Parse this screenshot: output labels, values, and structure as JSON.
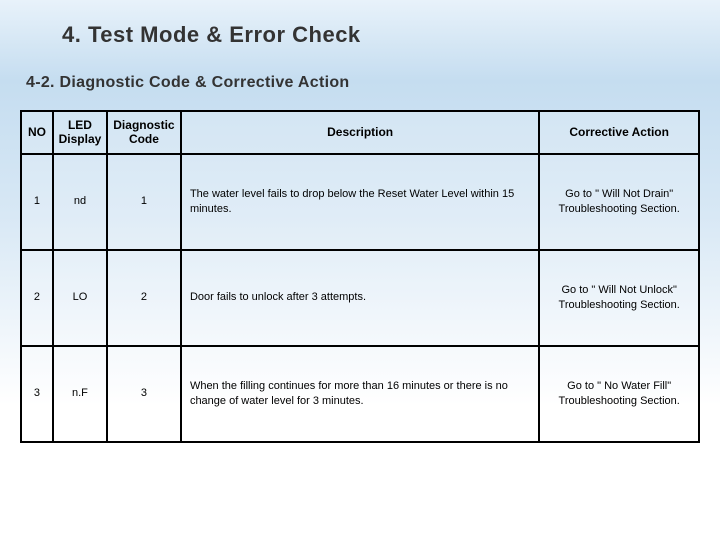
{
  "title": "4. Test Mode & Error Check",
  "subtitle": "4-2. Diagnostic Code & Corrective Action",
  "headers": {
    "no": "NO",
    "led": "LED Display",
    "code": "Diagnostic Code",
    "desc": "Description",
    "corr": "Corrective Action"
  },
  "rows": [
    {
      "no": "1",
      "led": "nd",
      "code": "1",
      "desc": "The water level fails to drop below the Reset Water Level within 15 minutes.",
      "corr": "Go to \" Will Not Drain\" Troubleshooting Section."
    },
    {
      "no": "2",
      "led": "LO",
      "code": "2",
      "desc": "Door fails to unlock after 3 attempts.",
      "corr": "Go to \" Will Not Unlock\" Troubleshooting Section."
    },
    {
      "no": "3",
      "led": "n.F",
      "code": "3",
      "desc": "When the filling continues for more than 16 minutes or there is no change of water level for 3 minutes.",
      "corr": "Go to \" No Water Fill\" Troubleshooting Section."
    }
  ]
}
